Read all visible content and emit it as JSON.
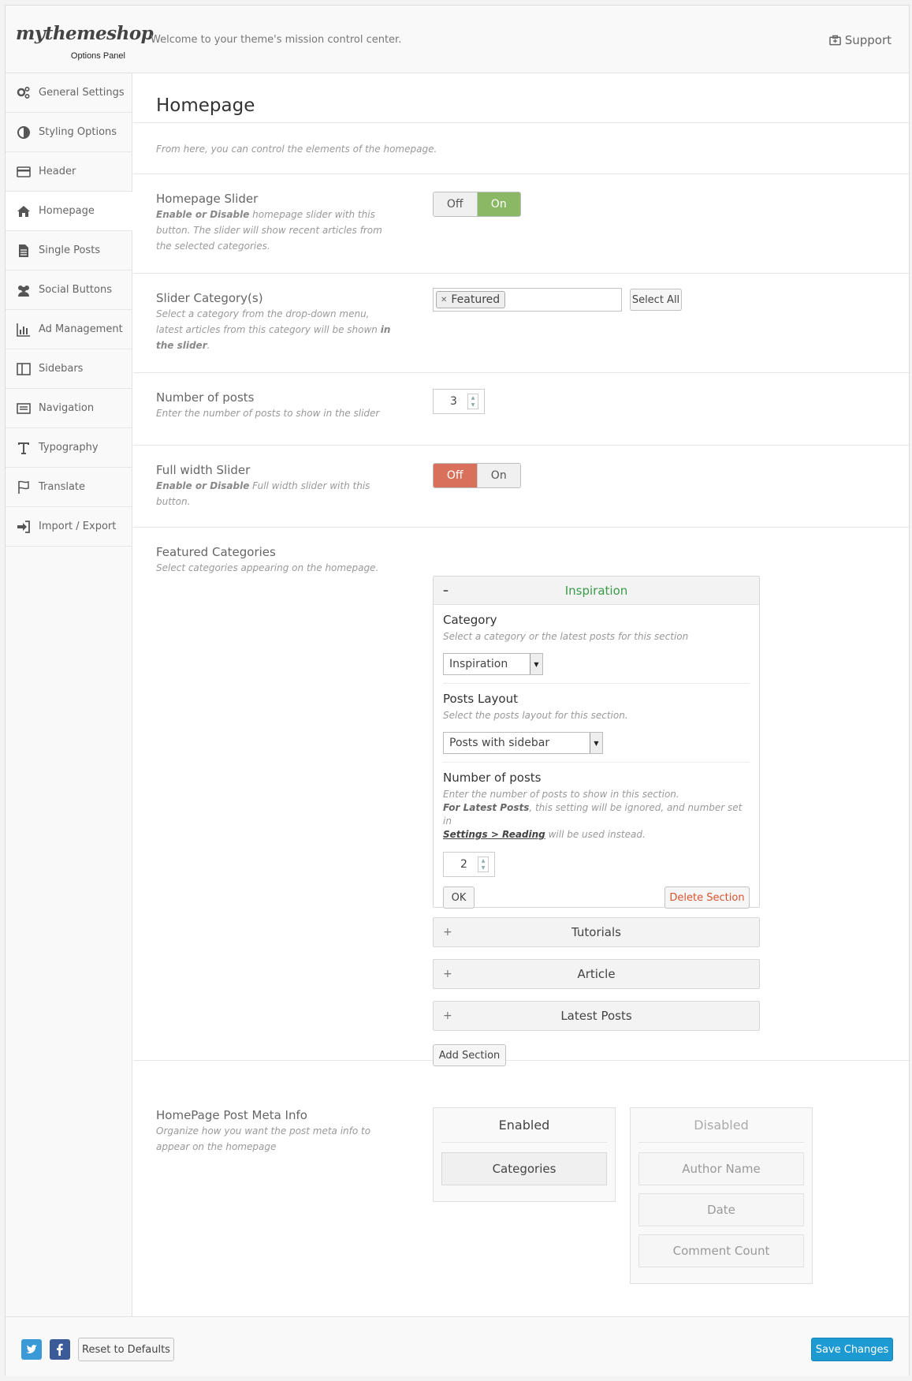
{
  "header": {
    "logo": "mythemeshop",
    "logo_sub": "Options Panel",
    "welcome": "Welcome to your theme's mission control center.",
    "support": "Support"
  },
  "sidebar": {
    "items": [
      {
        "label": "General Settings",
        "icon": "gears-icon"
      },
      {
        "label": "Styling Options",
        "icon": "contrast-icon"
      },
      {
        "label": "Header",
        "icon": "header-card-icon"
      },
      {
        "label": "Homepage",
        "icon": "home-icon",
        "active": true
      },
      {
        "label": "Single Posts",
        "icon": "document-icon"
      },
      {
        "label": "Social Buttons",
        "icon": "users-icon"
      },
      {
        "label": "Ad Management",
        "icon": "bar-chart-icon"
      },
      {
        "label": "Sidebars",
        "icon": "columns-icon"
      },
      {
        "label": "Navigation",
        "icon": "navigation-icon"
      },
      {
        "label": "Typography",
        "icon": "text-icon"
      },
      {
        "label": "Translate",
        "icon": "flag-icon"
      },
      {
        "label": "Import / Export",
        "icon": "sign-in-icon"
      }
    ]
  },
  "main": {
    "title": "Homepage",
    "intro": "From here, you can control the elements of the homepage.",
    "slider": {
      "title": "Homepage Slider",
      "desc_bold": "Enable or Disable",
      "desc_rest": " homepage slider with this button. The slider will show recent articles from the selected categories.",
      "off": "Off",
      "on": "On",
      "value": "On"
    },
    "slider_cats": {
      "title": "Slider Category(s)",
      "desc_start": "Select a category from the drop-down menu, latest articles from this category will be shown ",
      "desc_bold": "in the slider",
      "desc_end": ".",
      "tag": "Featured",
      "select_all": "Select All"
    },
    "num_posts": {
      "title": "Number of posts",
      "desc": "Enter the number of posts to show in the slider",
      "value": "3"
    },
    "full_width": {
      "title": "Full width Slider",
      "desc_bold": "Enable or Disable",
      "desc_rest": " Full width slider with this button.",
      "off": "Off",
      "on": "On",
      "value": "Off"
    },
    "featured": {
      "title": "Featured Categories",
      "desc": "Select categories appearing on the homepage.",
      "open_section": {
        "sign": "–",
        "title": "Inspiration",
        "title_color": "#3a9a4a",
        "category_title": "Category",
        "category_desc": "Select a category or the latest posts for this section",
        "category_value": "Inspiration",
        "layout_title": "Posts Layout",
        "layout_desc": "Select the posts layout for this section.",
        "layout_value": "Posts with sidebar",
        "num_title": "Number of posts",
        "num_desc1": "Enter the number of posts to show in this section.",
        "num_desc2_bold": "For Latest Posts",
        "num_desc2_rest": ", this setting will be ignored, and number set in ",
        "num_desc_link": "Settings > Reading",
        "num_desc_end": " will be used instead.",
        "num_value": "2",
        "ok": "OK",
        "delete": "Delete Section",
        "delete_color": "#d9532f"
      },
      "closed_sections": [
        {
          "sign": "+",
          "title": "Tutorials"
        },
        {
          "sign": "+",
          "title": "Article"
        },
        {
          "sign": "+",
          "title": "Latest Posts"
        }
      ],
      "add_section": "Add Section"
    },
    "meta": {
      "title": "HomePage Post Meta Info",
      "desc": "Organize how you want the post meta info to appear on the homepage",
      "enabled_title": "Enabled",
      "enabled_items": [
        "Categories"
      ],
      "disabled_title": "Disabled",
      "disabled_items": [
        "Author Name",
        "Date",
        "Comment Count"
      ]
    }
  },
  "footer": {
    "twitter_icon": "twitter-icon",
    "facebook_icon": "facebook-icon",
    "reset": "Reset to Defaults",
    "save": "Save Changes"
  },
  "colors": {
    "on_active": "#8bb864",
    "off_active": "#d9705c",
    "save": "#1e9ad2"
  }
}
